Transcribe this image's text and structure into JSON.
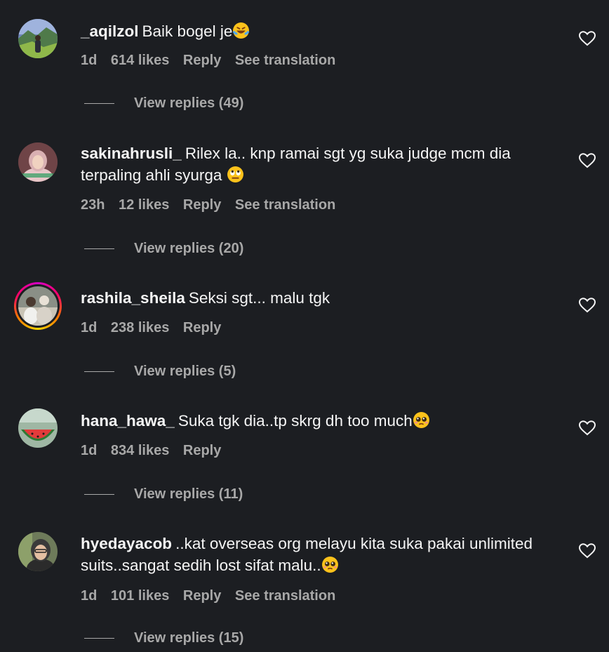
{
  "comments": [
    {
      "username": "_aqilzol",
      "text": "Baik bogel je",
      "emoji": "laughing-tears-emoji",
      "age": "1d",
      "likes": "614 likes",
      "reply": "Reply",
      "translation": "See translation",
      "view_replies": "View replies (49)"
    },
    {
      "username": "sakinahrusli_",
      "text": "Rilex la.. knp ramai sgt yg suka judge mcm dia terpaling ahli syurga",
      "emoji": "eye-roll-emoji",
      "age": "23h",
      "likes": "12 likes",
      "reply": "Reply",
      "translation": "See translation",
      "view_replies": "View replies (20)"
    },
    {
      "username": "rashila_sheila",
      "text": "Seksi sgt... malu tgk",
      "age": "1d",
      "likes": "238 likes",
      "reply": "Reply",
      "view_replies": "View replies (5)"
    },
    {
      "username": "hana_hawa_",
      "text": "Suka tgk dia..tp skrg dh too much",
      "emoji": "pleading-face-emoji",
      "age": "1d",
      "likes": "834 likes",
      "reply": "Reply",
      "view_replies": "View replies (11)"
    },
    {
      "username": "hyedayacob",
      "text": "..kat overseas org melayu kita suka pakai unlimited suits..sangat sedih lost sifat malu..",
      "emoji": "pleading-face-emoji",
      "age": "1d",
      "likes": "101 likes",
      "reply": "Reply",
      "translation": "See translation",
      "view_replies": "View replies (15)"
    }
  ],
  "colors": {
    "background": "#1c1e22",
    "text": "#f5f5f5",
    "secondary": "#a8a8a8"
  }
}
